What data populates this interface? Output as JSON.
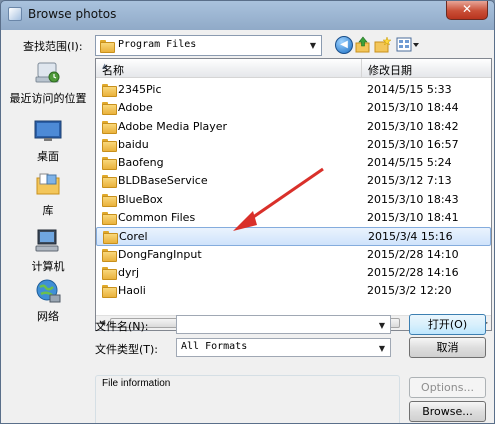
{
  "window": {
    "title": "Browse photos",
    "close_glyph": "✕"
  },
  "look_in": {
    "label": "查找范围(I):",
    "value": "Program Files"
  },
  "places": [
    {
      "label": "最近访问的位置",
      "icon": "recent-places-icon"
    },
    {
      "label": "桌面",
      "icon": "desktop-icon"
    },
    {
      "label": "库",
      "icon": "libraries-icon"
    },
    {
      "label": "计算机",
      "icon": "computer-icon"
    },
    {
      "label": "网络",
      "icon": "network-icon"
    }
  ],
  "columns": {
    "name": "名称",
    "date": "修改日期"
  },
  "files": [
    {
      "name": "2345Pic",
      "date": "2014/5/15 5:33"
    },
    {
      "name": "Adobe",
      "date": "2015/3/10 18:44"
    },
    {
      "name": "Adobe Media Player",
      "date": "2015/3/10 18:42"
    },
    {
      "name": "baidu",
      "date": "2015/3/10 16:57"
    },
    {
      "name": "Baofeng",
      "date": "2014/5/15 5:24"
    },
    {
      "name": "BLDBaseService",
      "date": "2015/3/12 7:13"
    },
    {
      "name": "BlueBox",
      "date": "2015/3/10 18:43"
    },
    {
      "name": "Common Files",
      "date": "2015/3/10 18:41"
    },
    {
      "name": "Corel",
      "date": "2015/3/4 15:16",
      "selected": true
    },
    {
      "name": "DongFangInput",
      "date": "2015/2/28 14:10"
    },
    {
      "name": "dyrj",
      "date": "2015/2/28 14:16"
    },
    {
      "name": "Haoli",
      "date": "2015/3/2 12:20"
    }
  ],
  "filename": {
    "label": "文件名(N):",
    "value": ""
  },
  "filetype": {
    "label": "文件类型(T):",
    "value": "All Formats"
  },
  "buttons": {
    "open": "打开(O)",
    "cancel": "取消",
    "options": "Options...",
    "browse": "Browse..."
  },
  "file_info": {
    "label": "File information"
  },
  "colors": {
    "annotation_arrow": "#d9302a",
    "selection": "#cfe3fb"
  }
}
